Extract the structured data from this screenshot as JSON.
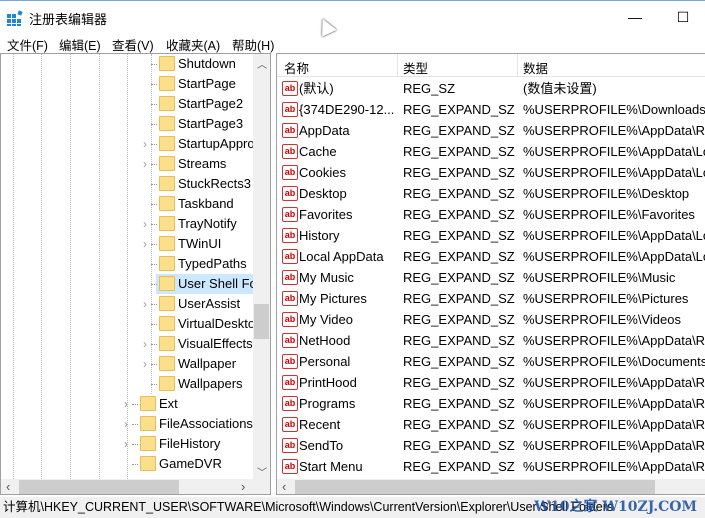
{
  "window": {
    "title": "注册表编辑器",
    "minimize": "—",
    "maximize": "☐"
  },
  "menu": [
    "文件(F)",
    "编辑(E)",
    "查看(V)",
    "收藏夹(A)",
    "帮助(H)"
  ],
  "tree": {
    "items": [
      {
        "label": "Shutdown",
        "expandable": false
      },
      {
        "label": "StartPage",
        "expandable": false
      },
      {
        "label": "StartPage2",
        "expandable": false
      },
      {
        "label": "StartPage3",
        "expandable": false
      },
      {
        "label": "StartupApprove",
        "expandable": true
      },
      {
        "label": "Streams",
        "expandable": true
      },
      {
        "label": "StuckRects3",
        "expandable": false
      },
      {
        "label": "Taskband",
        "expandable": false
      },
      {
        "label": "TrayNotify",
        "expandable": true
      },
      {
        "label": "TWinUI",
        "expandable": true
      },
      {
        "label": "TypedPaths",
        "expandable": false
      },
      {
        "label": "User Shell Folders",
        "expandable": false,
        "selected": true
      },
      {
        "label": "UserAssist",
        "expandable": true
      },
      {
        "label": "VirtualDesktops",
        "expandable": false
      },
      {
        "label": "VisualEffects",
        "expandable": true
      },
      {
        "label": "Wallpaper",
        "expandable": true
      },
      {
        "label": "Wallpapers",
        "expandable": false
      }
    ],
    "parent_items": [
      {
        "label": "Ext",
        "expandable": true
      },
      {
        "label": "FileAssociations",
        "expandable": true
      },
      {
        "label": "FileHistory",
        "expandable": true
      },
      {
        "label": "GameDVR",
        "expandable": false
      }
    ]
  },
  "list": {
    "columns": [
      "名称",
      "类型",
      "数据"
    ],
    "rows": [
      [
        "(默认)",
        "REG_SZ",
        "(数值未设置)"
      ],
      [
        "{374DE290-12...",
        "REG_EXPAND_SZ",
        "%USERPROFILE%\\Downloads"
      ],
      [
        "AppData",
        "REG_EXPAND_SZ",
        "%USERPROFILE%\\AppData\\Roa"
      ],
      [
        "Cache",
        "REG_EXPAND_SZ",
        "%USERPROFILE%\\AppData\\Loc"
      ],
      [
        "Cookies",
        "REG_EXPAND_SZ",
        "%USERPROFILE%\\AppData\\Loc"
      ],
      [
        "Desktop",
        "REG_EXPAND_SZ",
        "%USERPROFILE%\\Desktop"
      ],
      [
        "Favorites",
        "REG_EXPAND_SZ",
        "%USERPROFILE%\\Favorites"
      ],
      [
        "History",
        "REG_EXPAND_SZ",
        "%USERPROFILE%\\AppData\\Loc"
      ],
      [
        "Local AppData",
        "REG_EXPAND_SZ",
        "%USERPROFILE%\\AppData\\Loc"
      ],
      [
        "My Music",
        "REG_EXPAND_SZ",
        "%USERPROFILE%\\Music"
      ],
      [
        "My Pictures",
        "REG_EXPAND_SZ",
        "%USERPROFILE%\\Pictures"
      ],
      [
        "My Video",
        "REG_EXPAND_SZ",
        "%USERPROFILE%\\Videos"
      ],
      [
        "NetHood",
        "REG_EXPAND_SZ",
        "%USERPROFILE%\\AppData\\Roa"
      ],
      [
        "Personal",
        "REG_EXPAND_SZ",
        "%USERPROFILE%\\Documents"
      ],
      [
        "PrintHood",
        "REG_EXPAND_SZ",
        "%USERPROFILE%\\AppData\\Roa"
      ],
      [
        "Programs",
        "REG_EXPAND_SZ",
        "%USERPROFILE%\\AppData\\Roa"
      ],
      [
        "Recent",
        "REG_EXPAND_SZ",
        "%USERPROFILE%\\AppData\\Roa"
      ],
      [
        "SendTo",
        "REG_EXPAND_SZ",
        "%USERPROFILE%\\AppData\\Roa"
      ],
      [
        "Start Menu",
        "REG_EXPAND_SZ",
        "%USERPROFILE%\\AppData\\Roa"
      ]
    ],
    "value_icon": "ab"
  },
  "status": {
    "path": "计算机\\HKEY_CURRENT_USER\\SOFTWARE\\Microsoft\\Windows\\CurrentVersion\\Explorer\\User Shell Folders",
    "watermark": "W10之家 W10ZJ.COM"
  },
  "colors": {
    "selection": "#cce8ff",
    "folder": "#fcdf8a"
  }
}
